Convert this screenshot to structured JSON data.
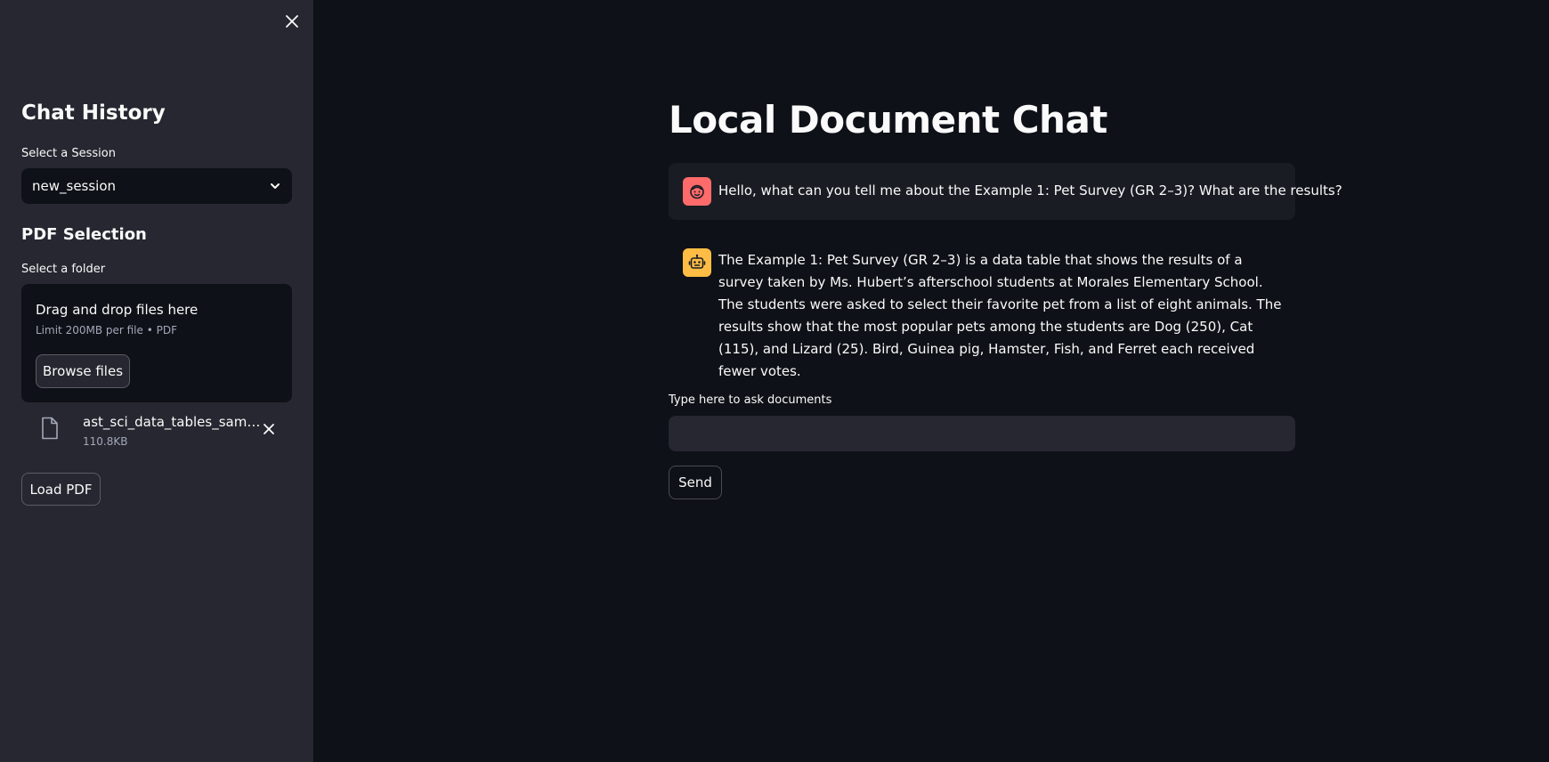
{
  "sidebar": {
    "title": "Chat History",
    "session_label": "Select a Session",
    "session_value": "new_session",
    "pdf_title": "PDF Selection",
    "folder_label": "Select a folder",
    "dropzone": {
      "title": "Drag and drop files here",
      "subtitle": "Limit 200MB per file • PDF",
      "browse_label": "Browse files"
    },
    "file": {
      "name": "ast_sci_data_tables_sampl...",
      "size": "110.8KB"
    },
    "load_label": "Load PDF"
  },
  "main": {
    "title": "Local Document Chat",
    "messages": [
      {
        "role": "user",
        "text": "Hello, what can you tell me about the Example 1: Pet Survey (GR 2–3)? What are the results?"
      },
      {
        "role": "assistant",
        "text": "The Example 1: Pet Survey (GR 2–3) is a data table that shows the results of a survey taken by Ms. Hubert’s afterschool students at Morales Elementary School. The students were asked to select their favorite pet from a list of eight animals. The results show that the most popular pets among the students are Dog (250), Cat (115), and Lizard (25). Bird, Guinea pig, Hamster, Fish, and Ferret each received fewer votes."
      }
    ],
    "input_label": "Type here to ask documents",
    "input_value": "",
    "send_label": "Send"
  },
  "icons": {
    "close": "close-icon",
    "dropdown": "chevron-down-icon",
    "file": "file-icon",
    "remove": "close-icon",
    "user_avatar": "face-icon",
    "assistant_avatar": "robot-icon"
  },
  "colors": {
    "background": "#0e1117",
    "sidebar": "#262730",
    "user_avatar": "#ff6b6b",
    "assistant_avatar": "#ffbd45"
  }
}
